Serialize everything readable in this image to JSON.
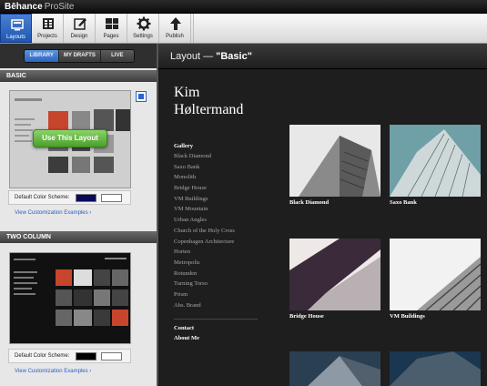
{
  "app": {
    "brand_left": "Bēhance",
    "brand_right": "ProSite"
  },
  "toolbar": {
    "items": [
      {
        "label": "Layouts",
        "icon": "layouts-icon",
        "active": true
      },
      {
        "label": "Projects",
        "icon": "projects-icon"
      },
      {
        "label": "Design",
        "icon": "design-icon"
      },
      {
        "label": "Pages",
        "icon": "pages-icon"
      },
      {
        "label": "Settings",
        "icon": "gear-icon"
      },
      {
        "label": "Publish",
        "icon": "arrow-up-icon"
      }
    ]
  },
  "sidebar": {
    "tabs": [
      "LIBRARY",
      "MY DRAFTS",
      "LIVE"
    ],
    "active_tab": "LIBRARY",
    "sections": [
      {
        "title": "BASIC",
        "use_button": "Use This Layout",
        "scheme_label": "Default Color Scheme:",
        "scheme_colors": [
          "#0a0a5a",
          "#ffffff"
        ],
        "link": "View Customization Examples ›"
      },
      {
        "title": "TWO COLUMN",
        "scheme_label": "Default Color Scheme:",
        "scheme_colors": [
          "#000000",
          "#ffffff"
        ],
        "link": "View Customization Examples ›"
      }
    ]
  },
  "main": {
    "title_prefix": "Layout — ",
    "title_name": "\"Basic\"",
    "site_name_line1": "Kim",
    "site_name_line2": "Høltermand",
    "nav_header": "Gallery",
    "nav_items": [
      "Black Diamond",
      "Saxo Bank",
      "Monolith",
      "Bridge House",
      "VM Buildings",
      "VM Mountain",
      "Urban Angles",
      "Church of the Holy Cross",
      "Copenhagen Architecture",
      "Horten",
      "Metropolis",
      "Rotunden",
      "Turning Torso",
      "Prism",
      "Abs. Brand"
    ],
    "nav_footer": [
      "Contact",
      "About Me"
    ],
    "gallery": [
      {
        "caption": "Black Diamond"
      },
      {
        "caption": "Saxo Bank"
      },
      {
        "caption": "Bridge House"
      },
      {
        "caption": "VM Buildings"
      },
      {
        "caption": ""
      },
      {
        "caption": ""
      }
    ]
  }
}
